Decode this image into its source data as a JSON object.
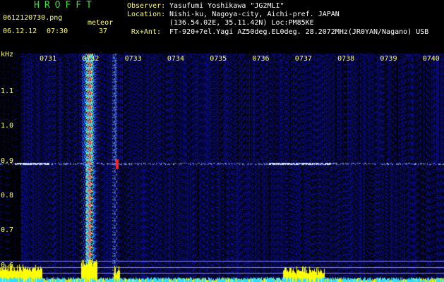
{
  "header": {
    "app_title": "HROFFT",
    "file_name": "0612120730.png",
    "record_date": "06.12.12",
    "record_time": "07:30",
    "meteor_label": "meteor",
    "meteor_count": "37",
    "observer_label": "Observer:",
    "observer_value": "Yasufumi Yoshikawa \"JG2MLI\"",
    "location_label": "Location:",
    "location_value": "Nishi-ku, Nagoya-city, Aichi-pref. JAPAN",
    "location_coords": "(136.54.02E, 35.11.42N) Loc:PM85KE",
    "rxant_label": "Rx+Ant:",
    "rxant_value": "FT-920+7el.Yagi AZ50deg.EL0deg. 28.2072MHz(JR0YAN/Nagano) USB"
  },
  "axes": {
    "freq_unit": "kHz",
    "time_ticks": [
      "0731",
      "0732",
      "0733",
      "0734",
      "0735",
      "0736",
      "0737",
      "0738",
      "0739",
      "0740"
    ],
    "freq_ticks": [
      "1.1",
      "1.0",
      "0.9",
      "0.8",
      "0.7",
      "0.6"
    ]
  },
  "colors": {
    "background": "#000000",
    "text_labels": "#ffff66",
    "text_values": "#ffffff",
    "title": "#2ee62e",
    "noise_blue": "#1a1a8c",
    "signal_cyan": "#33ddff",
    "signal_red": "#ff2020",
    "spectrum_yellow": "#ffff00",
    "gridline": "#8888ff"
  }
}
